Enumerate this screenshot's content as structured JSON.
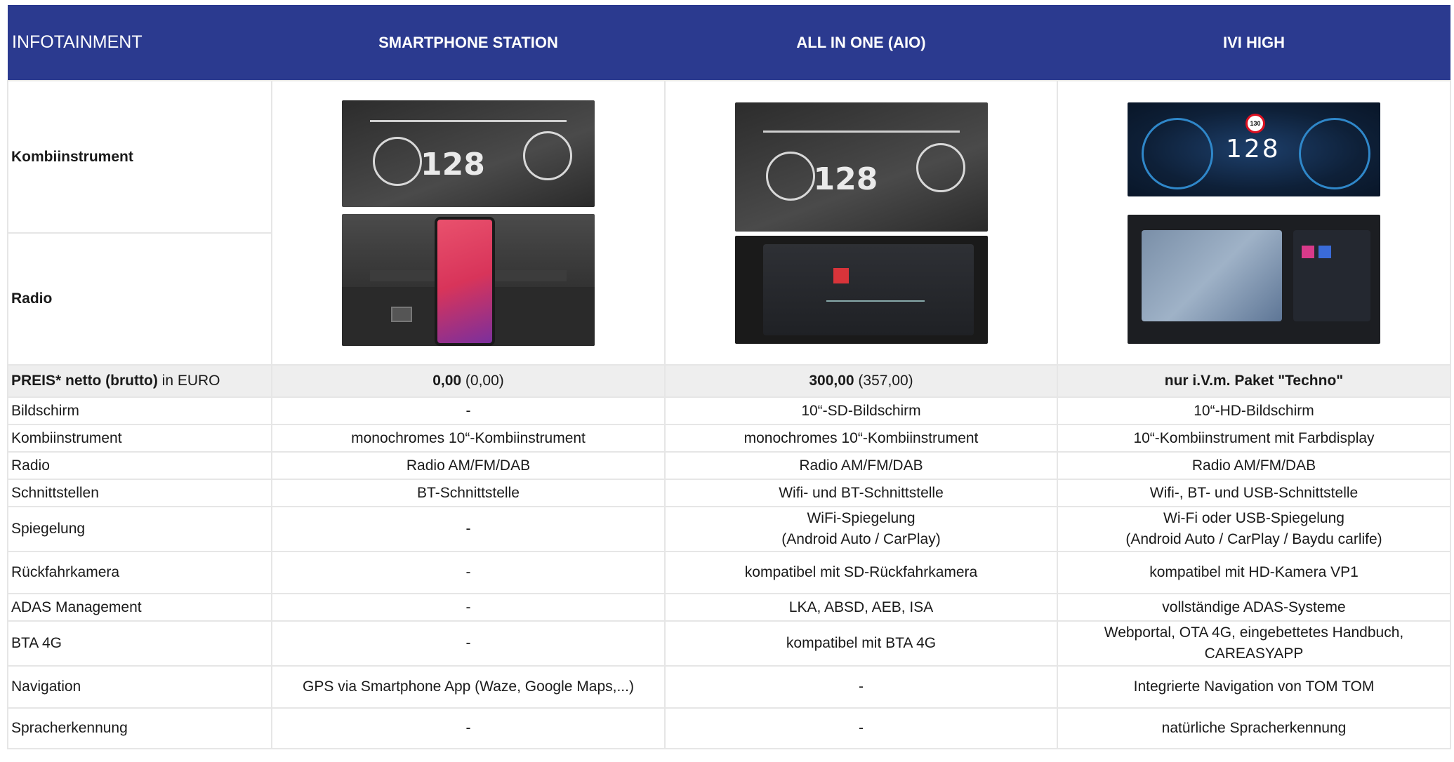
{
  "header": {
    "col0": "INFOTAINMENT",
    "col1": "SMARTPHONE STATION",
    "col2": "ALL IN ONE (AIO)",
    "col3": "IVI HIGH"
  },
  "image_rows": {
    "kombi_label": "Kombiinstrument",
    "radio_label": "Radio",
    "kombi_speed_mono": "128",
    "kombi_speed_color": "128",
    "kombi_limit": "130"
  },
  "price": {
    "label_bold": "PREIS* netto (brutto)",
    "label_rest": " in EURO",
    "c1_bold": "0,00",
    "c1_rest": " (0,00)",
    "c2_bold": "300,00",
    "c2_rest": " (357,00)",
    "c3_bold": "nur i.V.m. Paket \"Techno\""
  },
  "rows": [
    {
      "label": "Bildschirm",
      "c1": "-",
      "c2": "10“-SD-Bildschirm",
      "c3": "10“-HD-Bildschirm"
    },
    {
      "label": "Kombiinstrument",
      "c1": "monochromes 10“-Kombiinstrument",
      "c2": "monochromes 10“-Kombiinstrument",
      "c3": "10“-Kombiinstrument mit Farbdisplay"
    },
    {
      "label": "Radio",
      "c1": "Radio AM/FM/DAB",
      "c2": "Radio AM/FM/DAB",
      "c3": "Radio AM/FM/DAB"
    },
    {
      "label": "Schnittstellen",
      "c1": "BT-Schnittstelle",
      "c2": "Wifi- und BT-Schnittstelle",
      "c3": "Wifi-, BT- und USB-Schnittstelle"
    },
    {
      "label": "Spiegelung",
      "c1": "-",
      "c2a": "WiFi-Spiegelung",
      "c2b": "(Android Auto / CarPlay)",
      "c3a": "Wi-Fi oder USB-Spiegelung",
      "c3b": "(Android Auto / CarPlay / Baydu carlife)"
    },
    {
      "label": "Rückfahrkamera",
      "c1": "-",
      "c2": "kompatibel mit SD-Rückfahrkamera",
      "c3": "kompatibel mit HD-Kamera VP1"
    },
    {
      "label": "ADAS Management",
      "c1": "-",
      "c2": "LKA, ABSD, AEB, ISA",
      "c3": "vollständige ADAS-Systeme"
    },
    {
      "label": "BTA 4G",
      "c1": "-",
      "c2": "kompatibel mit BTA 4G",
      "c3a": "Webportal, OTA 4G, eingebettetes Handbuch,",
      "c3b": "CAREASYAPP"
    },
    {
      "label": "Navigation",
      "c1": "GPS via Smartphone App (Waze, Google Maps,...)",
      "c2": "-",
      "c3": "Integrierte Navigation von TOM TOM"
    },
    {
      "label": "Spracherkennung",
      "c1": "-",
      "c2": "-",
      "c3": "natürliche Spracherkennung"
    }
  ]
}
